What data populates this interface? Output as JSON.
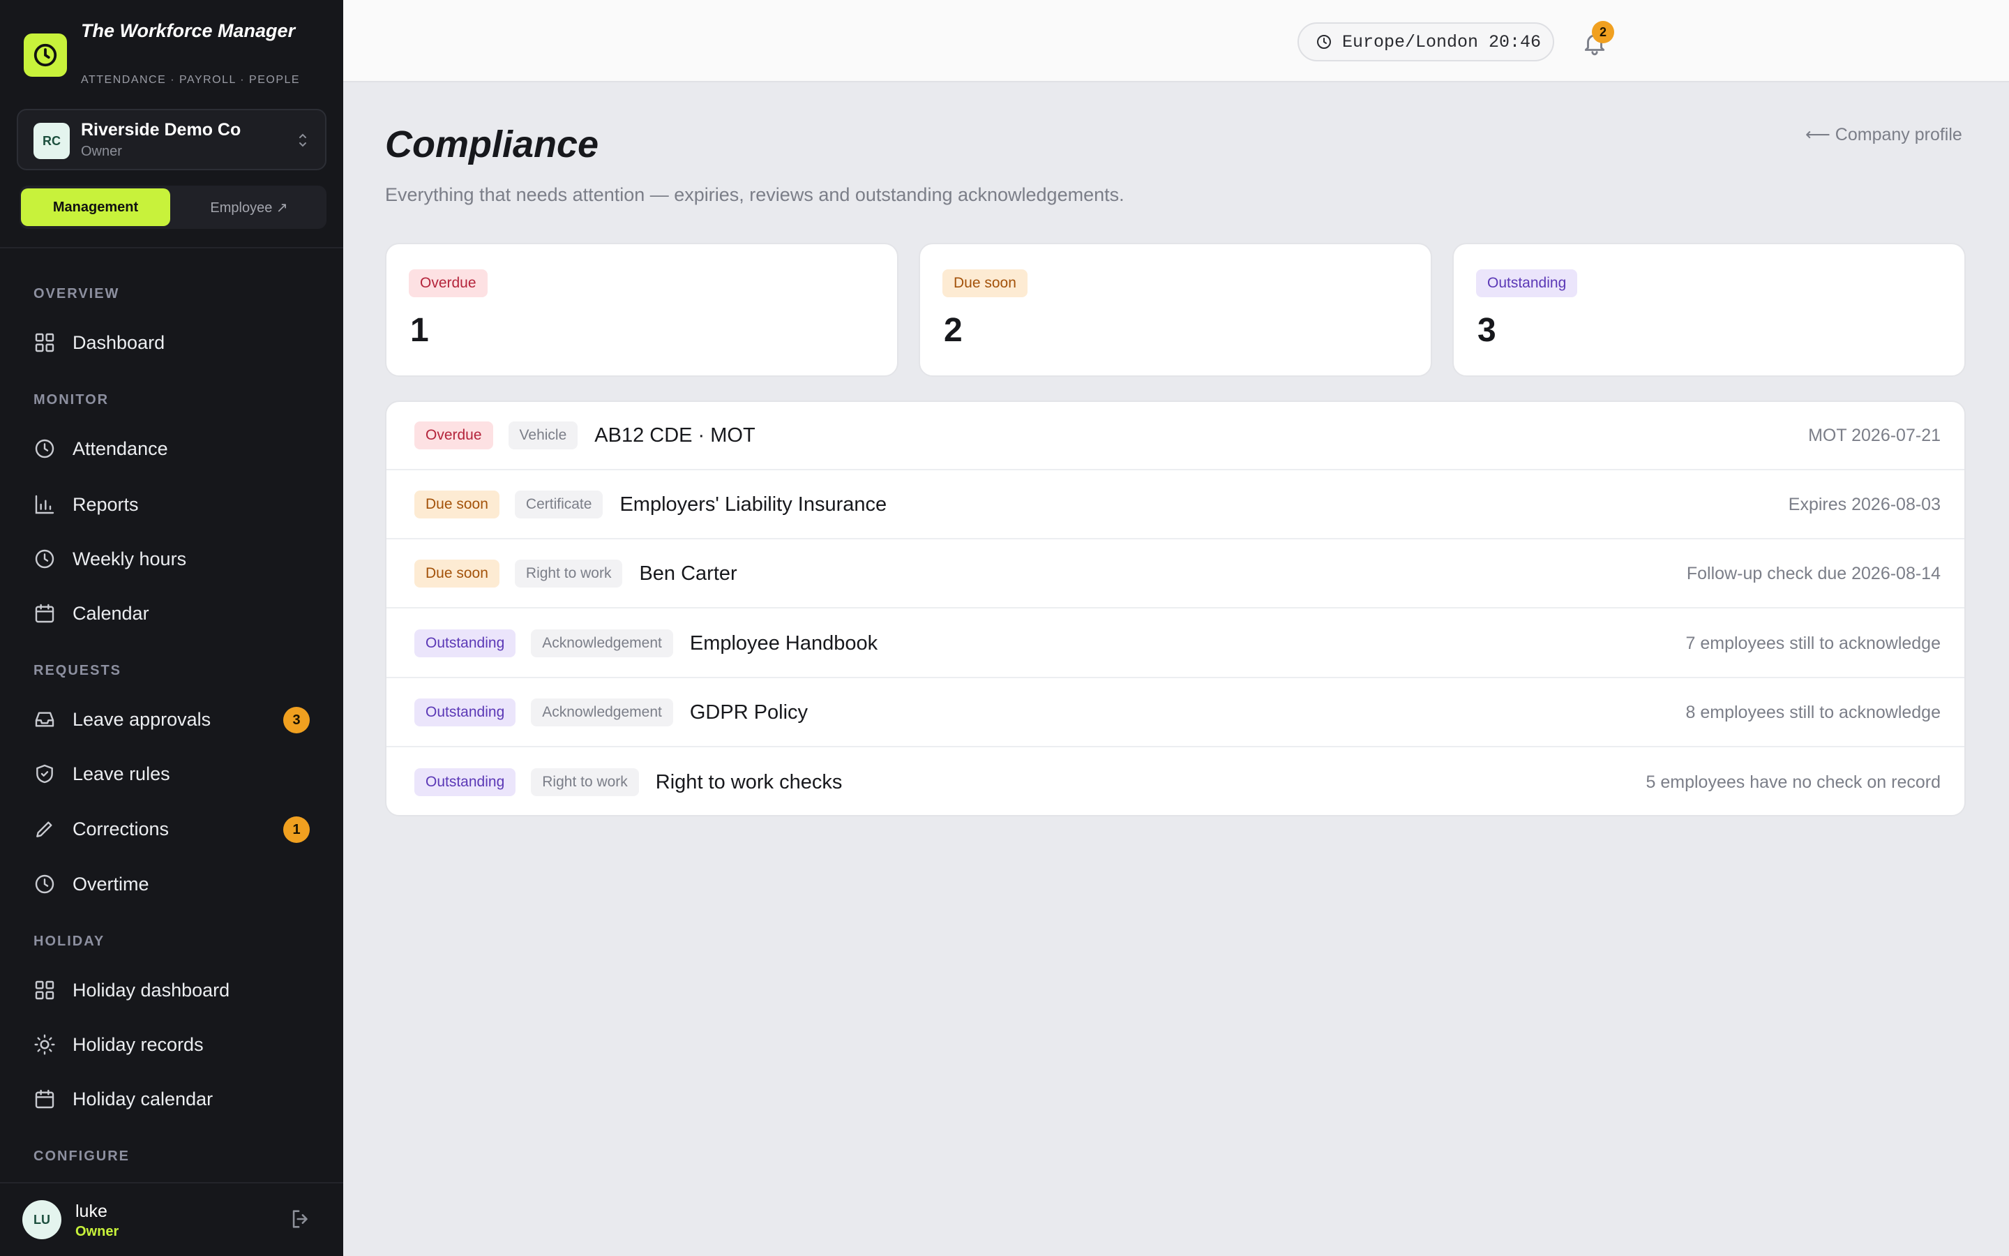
{
  "brand": {
    "title": "The Workforce Manager",
    "subtitle": "ATTENDANCE · PAYROLL · PEOPLE",
    "accent": "#c8f23b"
  },
  "company": {
    "initials": "RC",
    "name": "Riverside Demo Co",
    "role": "Owner"
  },
  "mode": {
    "management": "Management",
    "employee": "Employee ↗"
  },
  "nav": {
    "overview": {
      "heading": "OVERVIEW",
      "items": [
        {
          "label": "Dashboard",
          "icon": "grid-icon"
        }
      ]
    },
    "monitor": {
      "heading": "MONITOR",
      "items": [
        {
          "label": "Attendance",
          "icon": "clock-icon"
        },
        {
          "label": "Reports",
          "icon": "bar-chart-icon"
        },
        {
          "label": "Weekly hours",
          "icon": "clock-icon"
        },
        {
          "label": "Calendar",
          "icon": "calendar-icon"
        }
      ]
    },
    "requests": {
      "heading": "REQUESTS",
      "items": [
        {
          "label": "Leave approvals",
          "icon": "inbox-icon",
          "badge": "3"
        },
        {
          "label": "Leave rules",
          "icon": "shield-icon"
        },
        {
          "label": "Corrections",
          "icon": "pencil-icon",
          "badge": "1"
        },
        {
          "label": "Overtime",
          "icon": "clock-icon"
        }
      ]
    },
    "holiday": {
      "heading": "HOLIDAY",
      "items": [
        {
          "label": "Holiday dashboard",
          "icon": "grid-icon"
        },
        {
          "label": "Holiday records",
          "icon": "sun-icon"
        },
        {
          "label": "Holiday calendar",
          "icon": "calendar-icon"
        }
      ]
    },
    "configure": {
      "heading": "CONFIGURE"
    }
  },
  "user": {
    "initials": "LU",
    "name": "luke",
    "role": "Owner"
  },
  "topbar": {
    "timezone": "Europe/London 20:46",
    "notification_count": "2"
  },
  "page": {
    "title": "Compliance",
    "subtitle": "Everything that needs attention — expiries, reviews and outstanding acknowledgements.",
    "back_link": "⟵ Company profile"
  },
  "summary": [
    {
      "label": "Overdue",
      "value": "1",
      "tone": "red"
    },
    {
      "label": "Due soon",
      "value": "2",
      "tone": "orange"
    },
    {
      "label": "Outstanding",
      "value": "3",
      "tone": "purple"
    }
  ],
  "items": [
    {
      "status": "Overdue",
      "category": "Vehicle",
      "title": "AB12 CDE · MOT",
      "meta": "MOT 2026-07-21"
    },
    {
      "status": "Due soon",
      "category": "Certificate",
      "title": "Employers' Liability Insurance",
      "meta": "Expires 2026-08-03"
    },
    {
      "status": "Due soon",
      "category": "Right to work",
      "title": "Ben Carter",
      "meta": "Follow-up check due 2026-08-14"
    },
    {
      "status": "Outstanding",
      "category": "Acknowledgement",
      "title": "Employee Handbook",
      "meta": "7 employees still to acknowledge"
    },
    {
      "status": "Outstanding",
      "category": "Acknowledgement",
      "title": "GDPR Policy",
      "meta": "8 employees still to acknowledge"
    },
    {
      "status": "Outstanding",
      "category": "Right to work",
      "title": "Right to work checks",
      "meta": "5 employees have no check on record"
    }
  ],
  "colors": {
    "sidebar_bg": "#16171b",
    "badge": "#f0a020",
    "overdue": "#b4243b",
    "due_soon": "#a3520a",
    "outstanding": "#5b38b6"
  }
}
